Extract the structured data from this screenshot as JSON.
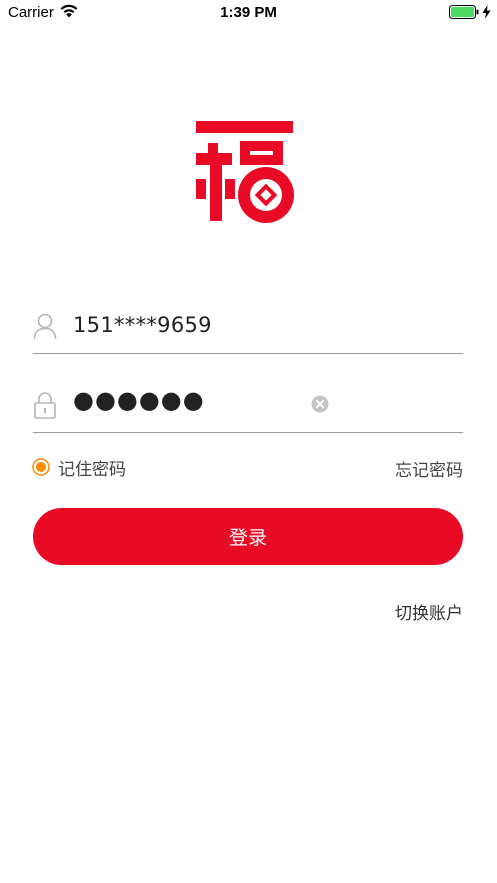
{
  "status_bar": {
    "carrier": "Carrier",
    "time": "1:39 PM",
    "wifi_icon": "wifi-icon",
    "battery_icon": "battery-full-icon",
    "battery_color": "#4cd964",
    "charging_icon": "charging-bolt-icon"
  },
  "logo": {
    "icon": "fu-character-logo",
    "color": "#e90b26"
  },
  "login_form": {
    "phone": {
      "icon": "user-icon",
      "value": "151****9659"
    },
    "password": {
      "icon": "lock-icon",
      "value": "●●●●●●",
      "clear_icon": "clear-icon"
    },
    "remember": {
      "label": "记住密码",
      "checked": true,
      "accent_color": "#ff8a00"
    },
    "forgot_label": "忘记密码",
    "login_label": "登录",
    "button_color": "#e90b26"
  },
  "switch_account_label": "切换账户"
}
